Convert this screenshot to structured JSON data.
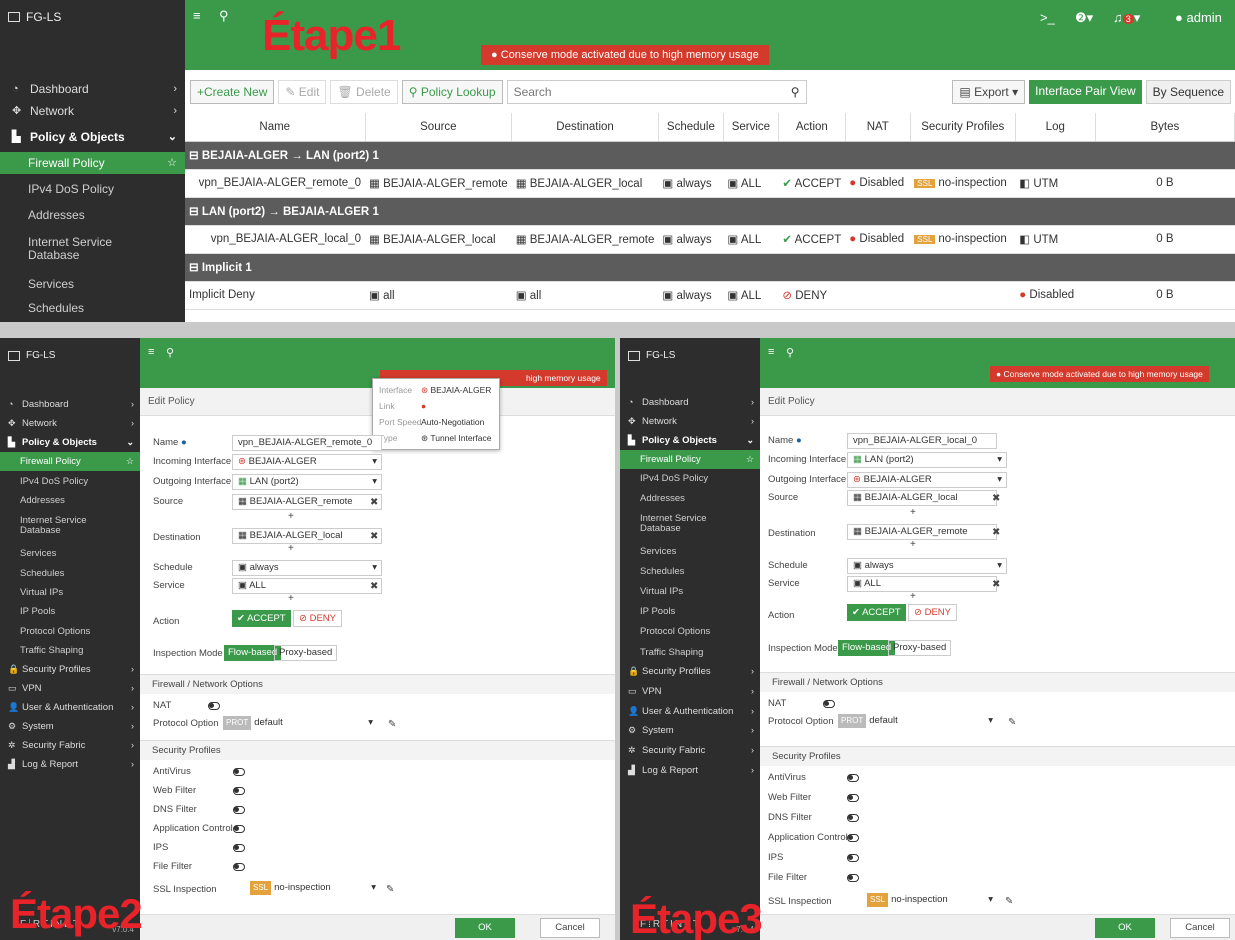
{
  "colors": {
    "brand_green": "#3a9a4a",
    "alert_red": "#d33a2c",
    "sidebar_dark": "#2d2d2d",
    "step_red": "#e8232a"
  },
  "step1": "Étape1",
  "step2": "Étape2",
  "step3": "Étape3",
  "top": {
    "device": "FG-LS",
    "alert": "Conserve mode activated due to high memory usage",
    "user": "admin",
    "notif_count": "3",
    "sidebar": [
      {
        "label": "Dashboard",
        "icon": "dashboard-icon"
      },
      {
        "label": "Network",
        "icon": "network-icon"
      },
      {
        "label": "Policy & Objects",
        "icon": "policy-icon"
      },
      {
        "label": "Firewall Policy"
      },
      {
        "label": "IPv4 DoS Policy"
      },
      {
        "label": "Addresses"
      },
      {
        "label": "Internet Service Database"
      },
      {
        "label": "Services"
      },
      {
        "label": "Schedules"
      }
    ],
    "toolbar": {
      "create": "+Create New",
      "edit": "Edit",
      "delete": "Delete",
      "lookup": "Policy Lookup",
      "search_ph": "Search",
      "export": "Export",
      "pair_view": "Interface Pair View",
      "by_seq": "By Sequence"
    },
    "columns": [
      "Name",
      "Source",
      "Destination",
      "Schedule",
      "Service",
      "Action",
      "NAT",
      "Security Profiles",
      "Log",
      "Bytes"
    ],
    "groups": [
      {
        "header": "BEJAIA-ALGER → LAN (port2)",
        "count": "1",
        "row": {
          "name": "vpn_BEJAIA-ALGER_remote_0",
          "source": "BEJAIA-ALGER_remote",
          "destination": "BEJAIA-ALGER_local",
          "schedule": "always",
          "service": "ALL",
          "action": "ACCEPT",
          "nat": "Disabled",
          "ssl": "SSL",
          "profile": "no-inspection",
          "log": "UTM",
          "bytes": "0 B"
        }
      },
      {
        "header": "LAN (port2) → BEJAIA-ALGER",
        "count": "1",
        "row": {
          "name": "vpn_BEJAIA-ALGER_local_0",
          "source": "BEJAIA-ALGER_local",
          "destination": "BEJAIA-ALGER_remote",
          "schedule": "always",
          "service": "ALL",
          "action": "ACCEPT",
          "nat": "Disabled",
          "ssl": "SSL",
          "profile": "no-inspection",
          "log": "UTM",
          "bytes": "0 B"
        }
      },
      {
        "header": "Implicit",
        "count": "1",
        "row": {
          "name": "Implicit Deny",
          "source": "all",
          "destination": "all",
          "schedule": "always",
          "service": "ALL",
          "action": "DENY",
          "nat": "",
          "ssl": "",
          "profile": "",
          "log": "Disabled",
          "bytes": "0 B"
        }
      }
    ]
  },
  "edit": {
    "device": "FG-LS",
    "alert": "Conserve mode activated due to high memory usage",
    "alert_partial": "high memory usage",
    "crumb": "Edit Policy",
    "sidebar": [
      "Dashboard",
      "Network",
      "Policy & Objects",
      "Firewall Policy",
      "IPv4 DoS Policy",
      "Addresses",
      "Internet Service Database",
      "Services",
      "Schedules",
      "Virtual IPs",
      "IP Pools",
      "Protocol Options",
      "Traffic Shaping",
      "Security Profiles",
      "VPN",
      "User & Authentication",
      "System",
      "Security Fabric",
      "Log & Report"
    ],
    "labels": {
      "name": "Name",
      "in": "Incoming Interface",
      "out": "Outgoing Interface",
      "source": "Source",
      "destination": "Destination",
      "schedule": "Schedule",
      "service": "Service",
      "action": "Action",
      "mode": "Inspection Mode",
      "fw_section": "Firewall / Network Options",
      "nat": "NAT",
      "proto": "Protocol Options",
      "sec_section": "Security Profiles",
      "av": "AntiVirus",
      "web": "Web Filter",
      "dns": "DNS Filter",
      "app": "Application Control",
      "ips": "IPS",
      "file": "File Filter",
      "ssl": "SSL Inspection"
    },
    "values": {
      "accept": "ACCEPT",
      "deny": "DENY",
      "flow": "Flow-based",
      "proxy": "Proxy-based",
      "schedule": "always",
      "service": "ALL",
      "proto": "default",
      "proto_badge": "PROT",
      "ssl": "no-inspection",
      "ssl_badge": "SSL",
      "ok": "OK",
      "cancel": "Cancel",
      "version": "v7.0.4"
    },
    "p2": {
      "name": "vpn_BEJAIA-ALGER_remote_0",
      "in": "BEJAIA-ALGER",
      "out": "LAN (port2)",
      "source": "BEJAIA-ALGER_remote",
      "destination": "BEJAIA-ALGER_local"
    },
    "p3": {
      "name": "vpn_BEJAIA-ALGER_local_0",
      "in": "LAN (port2)",
      "out": "BEJAIA-ALGER",
      "source": "BEJAIA-ALGER_local",
      "destination": "BEJAIA-ALGER_remote"
    },
    "tooltip": {
      "k1": "Interface",
      "v1": "BEJAIA-ALGER",
      "k2": "Link",
      "k3": "Port Speed",
      "v3": "Auto-Negotiation",
      "k4": "Type",
      "v4": "Tunnel Interface"
    }
  }
}
